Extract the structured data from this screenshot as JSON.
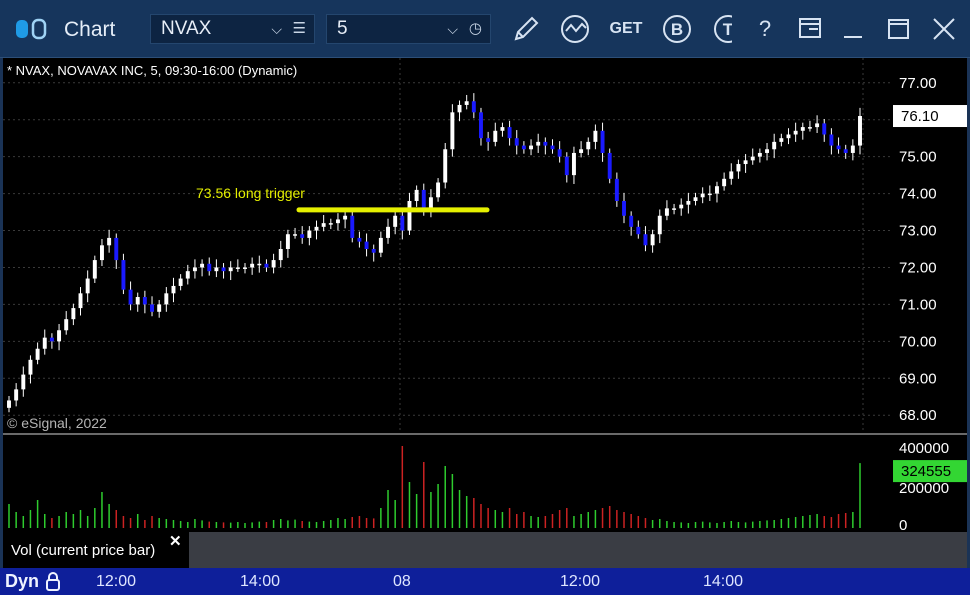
{
  "window": {
    "title": "Chart",
    "icons": [
      "chart-app-icon",
      "pencil-icon",
      "study-icon",
      "get-icon",
      "b-icon",
      "t-icon",
      "help-icon",
      "layout-icon",
      "minimize-icon",
      "maximize-icon",
      "close-icon"
    ],
    "help_label": "?",
    "get_label": "GET",
    "b_label": "B",
    "t_label": "T"
  },
  "symbol_combo": {
    "value": "NVAX"
  },
  "interval_combo": {
    "value": "5"
  },
  "chart": {
    "header": "* NVAX, NOVAVAX INC, 5, 09:30-16:00 (Dynamic)",
    "watermark": "© eSignal, 2022",
    "annotation": "73.56 long trigger",
    "price_ticks": [
      "77.00",
      "76.00",
      "75.00",
      "74.00",
      "73.00",
      "72.00",
      "71.00",
      "70.00",
      "69.00",
      "68.00"
    ],
    "last_price": "76.10",
    "volume_ticks": [
      "400000",
      "200000",
      "0"
    ],
    "last_volume": "324555",
    "volume_panel_label": "Vol (current price bar)",
    "panel_close": "✕",
    "colors": {
      "up": "#ffffff",
      "down": "#1a1aff",
      "vol_up": "#2ecc2e",
      "vol_down": "#cc2222",
      "trigger": "#e5f000",
      "last_price_bg": "#ffffff",
      "last_volume_bg": "#33d633"
    }
  },
  "time_axis": {
    "dyn_label": "Dyn",
    "ticks": [
      "12:00",
      "14:00",
      "08",
      "12:00",
      "14:00"
    ]
  },
  "chart_data": {
    "type": "candlestick",
    "symbol": "NVAX",
    "ylim": [
      67.6,
      77.4
    ],
    "trigger_price": 73.56,
    "x_ticks": [
      "12:00",
      "14:00",
      "08",
      "12:00",
      "14:00"
    ],
    "closes": [
      68.4,
      68.7,
      69.1,
      69.5,
      69.8,
      70.1,
      70.0,
      70.3,
      70.6,
      70.9,
      71.3,
      71.7,
      72.2,
      72.6,
      72.8,
      72.2,
      71.4,
      71.0,
      71.2,
      71.0,
      70.8,
      71.0,
      71.3,
      71.5,
      71.7,
      71.9,
      72.0,
      72.1,
      71.9,
      72.0,
      71.9,
      72.0,
      72.0,
      72.0,
      72.1,
      72.1,
      72.0,
      72.2,
      72.5,
      72.9,
      72.9,
      72.8,
      73.0,
      73.1,
      73.2,
      73.2,
      73.3,
      73.4,
      72.8,
      72.7,
      72.5,
      72.4,
      72.8,
      73.1,
      73.4,
      73.0,
      73.8,
      74.1,
      73.6,
      73.9,
      74.3,
      75.2,
      76.2,
      76.4,
      76.5,
      76.2,
      75.5,
      75.4,
      75.7,
      75.8,
      75.5,
      75.3,
      75.2,
      75.3,
      75.4,
      75.3,
      75.2,
      75.0,
      74.5,
      75.1,
      75.2,
      75.4,
      75.7,
      75.1,
      74.4,
      73.8,
      73.4,
      73.1,
      72.9,
      72.6,
      72.9,
      73.4,
      73.6,
      73.6,
      73.7,
      73.8,
      73.9,
      74.0,
      74.0,
      74.2,
      74.4,
      74.6,
      74.8,
      74.9,
      75.0,
      75.1,
      75.2,
      75.4,
      75.5,
      75.6,
      75.7,
      75.8,
      75.8,
      75.9,
      75.6,
      75.3,
      75.2,
      75.1,
      75.3,
      76.1
    ],
    "volumes": [
      120000,
      80000,
      60000,
      90000,
      140000,
      70000,
      50000,
      60000,
      80000,
      70000,
      90000,
      60000,
      100000,
      180000,
      120000,
      90000,
      60000,
      50000,
      70000,
      40000,
      60000,
      50000,
      45000,
      40000,
      35000,
      30000,
      45000,
      38000,
      32000,
      30000,
      28000,
      27000,
      30000,
      25000,
      28000,
      32000,
      30000,
      40000,
      45000,
      38000,
      42000,
      35000,
      32000,
      30000,
      35000,
      40000,
      50000,
      45000,
      55000,
      60000,
      50000,
      48000,
      100000,
      190000,
      140000,
      410000,
      230000,
      170000,
      330000,
      180000,
      220000,
      310000,
      270000,
      190000,
      160000,
      150000,
      120000,
      100000,
      90000,
      80000,
      100000,
      70000,
      80000,
      60000,
      55000,
      60000,
      70000,
      90000,
      100000,
      60000,
      70000,
      80000,
      90000,
      100000,
      110000,
      90000,
      80000,
      70000,
      60000,
      50000,
      40000,
      45000,
      35000,
      30000,
      28000,
      25000,
      30000,
      32000,
      28000,
      25000,
      30000,
      35000,
      30000,
      28000,
      32000,
      35000,
      38000,
      40000,
      45000,
      50000,
      55000,
      60000,
      65000,
      70000,
      60000,
      55000,
      70000,
      75000,
      80000,
      324555
    ]
  }
}
